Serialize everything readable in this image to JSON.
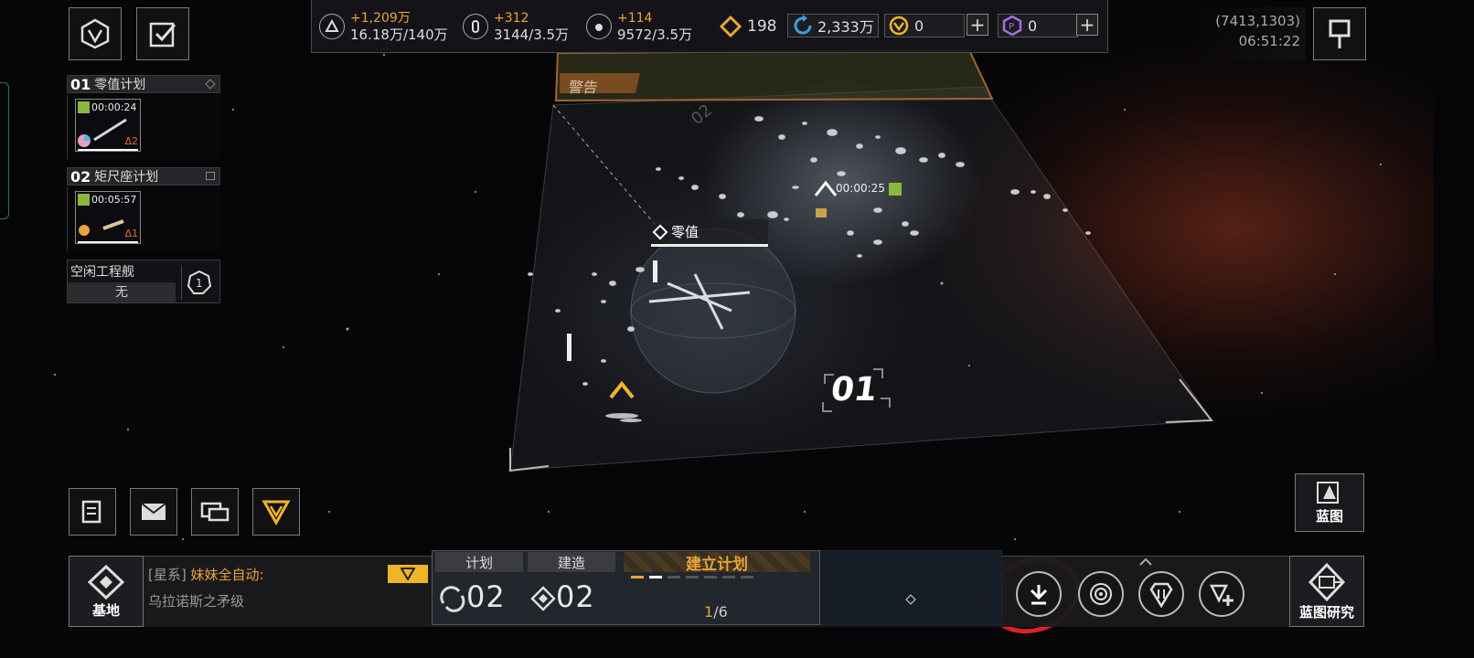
{
  "resources": {
    "r1": {
      "gain": "+1,209万",
      "current": "16.18万/140万"
    },
    "r2": {
      "gain": "+312",
      "current": "3144/3.5万"
    },
    "r3": {
      "gain": "+114",
      "current": "9572/3.5万"
    },
    "r4": {
      "value": "198"
    },
    "r5": {
      "value": "2,333万"
    },
    "r6": {
      "value": "0"
    },
    "r7": {
      "value": "0"
    }
  },
  "location": {
    "coords": "(7413,1303)",
    "time": "06:51:22"
  },
  "plans": [
    {
      "num": "01",
      "name": "零值计划",
      "timer": "00:00:24",
      "level": "Δ2"
    },
    {
      "num": "02",
      "name": "矩尺座计划",
      "timer": "00:05:57",
      "level": "Δ1"
    }
  ],
  "idle": {
    "label": "空闲工程舰",
    "value": "无"
  },
  "scene": {
    "warning": "警告",
    "station_label": "零值",
    "timer": "00:00:25",
    "zone_num": "01",
    "zone_num2": "02"
  },
  "chat": {
    "channel": "[星系]",
    "sender": "妹妹全自动:",
    "message": "乌拉诺斯之矛级"
  },
  "base_label": "基地",
  "tabs": {
    "plan": "计划",
    "build": "建造",
    "create": "建立计划"
  },
  "counts": {
    "plan": "02",
    "build": "02",
    "progress_cur": "1",
    "progress_total": "/6"
  },
  "blueprint_label": "蓝图",
  "blueprint_research_label": "蓝图研究",
  "colors": {
    "accent": "#e8a43a",
    "chip_yellow": "#f0b429",
    "purple": "#a070e0",
    "annotation_red": "#e0202a"
  }
}
